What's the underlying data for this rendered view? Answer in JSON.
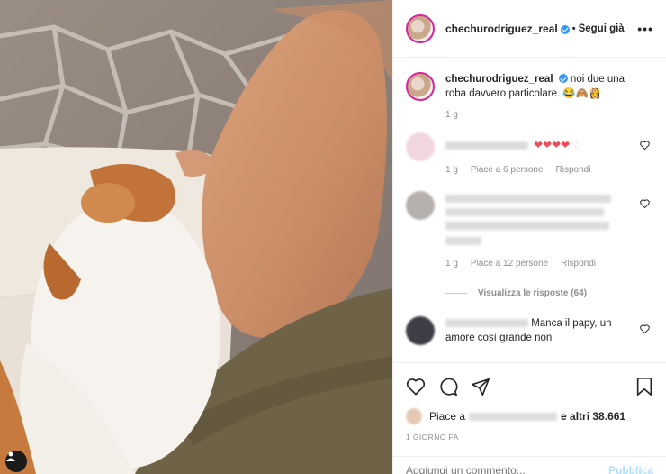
{
  "post": {
    "username": "chechurodriguez_real",
    "follow_label": "Segui già",
    "more_label": "•••",
    "caption_text": "noi due una roba davvero particolare.",
    "caption_emojis": "😂🙈👸",
    "caption_age": "1 g"
  },
  "comments": [
    {
      "text": "❤❤❤❤",
      "age": "1 g",
      "likes": "Piace a 6 persone",
      "reply": "Rispondi"
    },
    {
      "text": "",
      "age": "1 g",
      "likes": "Piace a 12 persone",
      "reply": "Rispondi",
      "view_replies": "Visualizza le risposte (64)"
    },
    {
      "text": "Manca il papy, un amore così grande non"
    }
  ],
  "likes": {
    "prefix": "Piace a",
    "suffix": "e altri 38.661"
  },
  "date": "1 GIORNO FA",
  "composer": {
    "placeholder": "Aggiungi un commento...",
    "publish": "Pubblica"
  },
  "icons": {
    "like": "heart-icon",
    "comment": "comment-icon",
    "share": "share-icon",
    "save": "bookmark-icon"
  },
  "colors": {
    "verified": "#3897f0",
    "heart_red": "#ed4956",
    "publish_disabled": "#b2dffc"
  }
}
